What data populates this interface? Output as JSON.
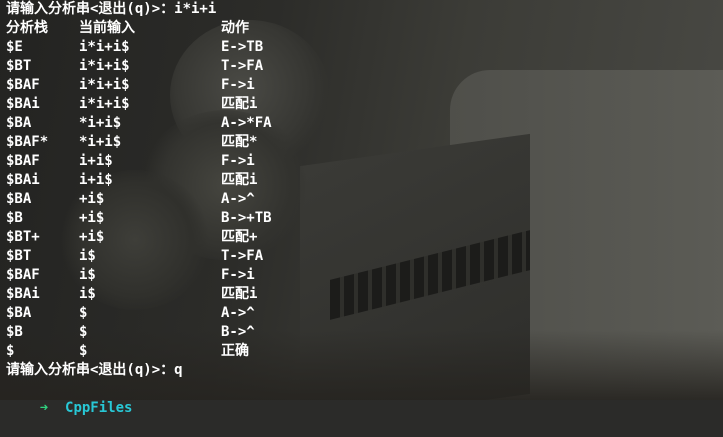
{
  "prompt_line": "请输入分析串<退出(q)>：i*i+i",
  "headers": {
    "stack": "分析栈",
    "input": "当前输入",
    "action": "动作"
  },
  "rows": [
    {
      "stack": "$E",
      "input": "i*i+i$",
      "action": "E->TB"
    },
    {
      "stack": "$BT",
      "input": "i*i+i$",
      "action": "T->FA"
    },
    {
      "stack": "$BAF",
      "input": "i*i+i$",
      "action": "F->i"
    },
    {
      "stack": "$BAi",
      "input": "i*i+i$",
      "action": "匹配i"
    },
    {
      "stack": "$BA",
      "input": "*i+i$",
      "action": "A->*FA"
    },
    {
      "stack": "$BAF*",
      "input": "*i+i$",
      "action": "匹配*"
    },
    {
      "stack": "$BAF",
      "input": "i+i$",
      "action": "F->i"
    },
    {
      "stack": "$BAi",
      "input": "i+i$",
      "action": "匹配i"
    },
    {
      "stack": "$BA",
      "input": "+i$",
      "action": "A->^"
    },
    {
      "stack": "$B",
      "input": "+i$",
      "action": "B->+TB"
    },
    {
      "stack": "$BT+",
      "input": "+i$",
      "action": "匹配+"
    },
    {
      "stack": "$BT",
      "input": "i$",
      "action": "T->FA"
    },
    {
      "stack": "$BAF",
      "input": "i$",
      "action": "F->i"
    },
    {
      "stack": "$BAi",
      "input": "i$",
      "action": "匹配i"
    },
    {
      "stack": "$BA",
      "input": "$",
      "action": "A->^"
    },
    {
      "stack": "$B",
      "input": "$",
      "action": "B->^"
    },
    {
      "stack": "$",
      "input": "$",
      "action": "正确"
    }
  ],
  "quit_line": "请输入分析串<退出(q)>：q",
  "shell_prompt": {
    "arrow": "➜",
    "directory": "CppFiles",
    "arrow_color": "#30d27f",
    "directory_color": "#28c8d6"
  }
}
